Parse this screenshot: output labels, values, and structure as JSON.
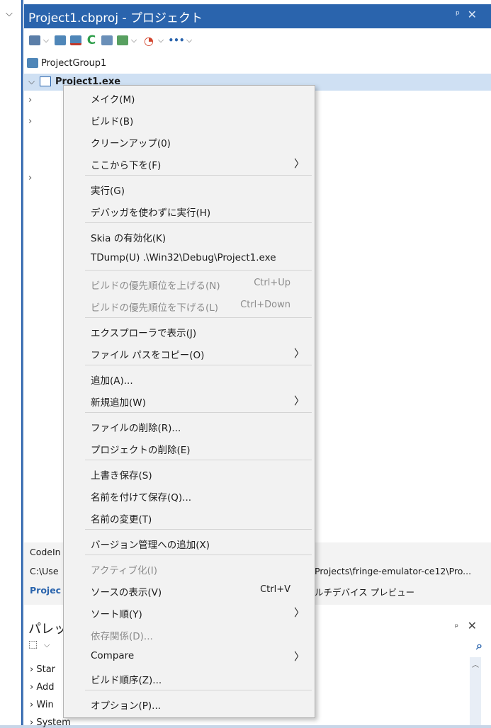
{
  "title_bar": {
    "title": "Project1.cbproj - プロジェクト",
    "pin": "ᵖ",
    "close": "✕"
  },
  "tree": {
    "group": "ProjectGroup1",
    "project": "Project1.exe"
  },
  "info": {
    "line1": "CodeIn",
    "line2_left": "C:\\Use",
    "line2_right": "Projects\\fringe-emulator-ce12\\Pro...",
    "line3_left": "Projec",
    "line3_right": "ルチデバイス プレビュー"
  },
  "palette": {
    "title": "パレッ",
    "items": [
      "Star",
      "Add",
      "Win",
      "System"
    ]
  },
  "menu": {
    "items": [
      {
        "label": "メイク(M)"
      },
      {
        "label": "ビルド(B)"
      },
      {
        "label": "クリーンアップ(0)"
      },
      {
        "label": "ここから下を(F)",
        "submenu": true
      },
      {
        "label": "実行(G)"
      },
      {
        "label": "デバッガを使わずに実行(H)"
      },
      {
        "label": "Skia の有効化(K)"
      },
      {
        "label": "TDump(U) .\\Win32\\Debug\\Project1.exe"
      },
      {
        "label": "ビルドの優先順位を上げる(N)",
        "shortcut": "Ctrl+Up",
        "disabled": true
      },
      {
        "label": "ビルドの優先順位を下げる(L)",
        "shortcut": "Ctrl+Down",
        "disabled": true
      },
      {
        "label": "エクスプローラで表示(J)"
      },
      {
        "label": "ファイル パスをコピー(O)",
        "submenu": true
      },
      {
        "label": "追加(A)..."
      },
      {
        "label": "新規追加(W)",
        "submenu": true
      },
      {
        "label": "ファイルの削除(R)..."
      },
      {
        "label": "プロジェクトの削除(E)"
      },
      {
        "label": "上書き保存(S)"
      },
      {
        "label": "名前を付けて保存(Q)..."
      },
      {
        "label": "名前の変更(T)"
      },
      {
        "label": "バージョン管理への追加(X)"
      },
      {
        "label": "アクティブ化(I)",
        "disabled": true
      },
      {
        "label": "ソースの表示(V)",
        "shortcut": "Ctrl+V"
      },
      {
        "label": "ソート順(Y)",
        "submenu": true
      },
      {
        "label": "依存関係(D)...",
        "disabled": true
      },
      {
        "label": "Compare",
        "submenu": true
      },
      {
        "label": "ビルド順序(Z)..."
      },
      {
        "label": "オプション(P)..."
      }
    ],
    "submenu_arrow": "〉"
  },
  "colors": {
    "title_bar": "#2a64ad",
    "selection": "#cfe0f3",
    "menu_bg": "#f2f2f2"
  }
}
